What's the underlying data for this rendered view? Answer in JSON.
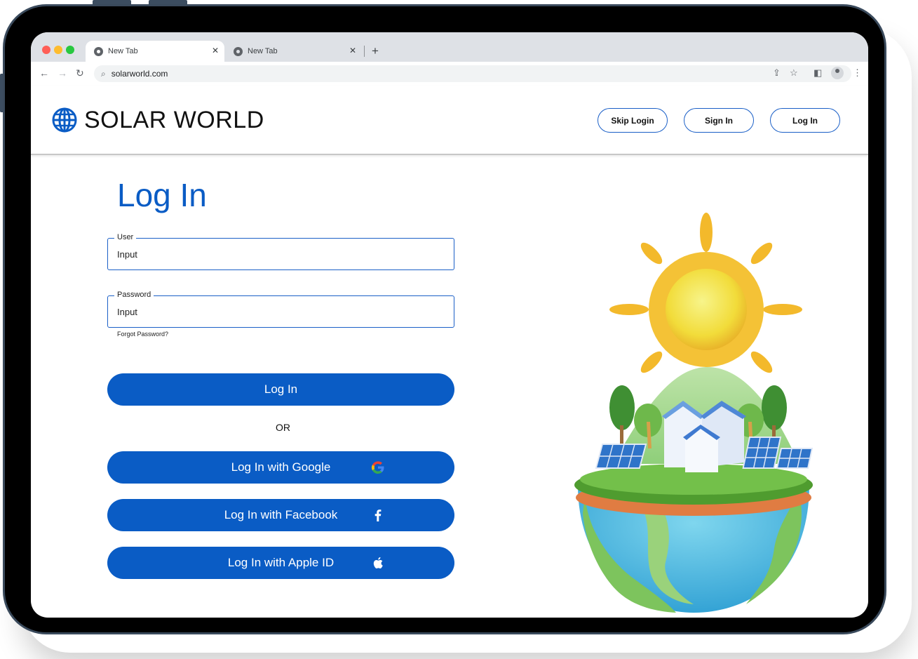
{
  "browser": {
    "tabs": [
      {
        "title": "New Tab"
      },
      {
        "title": "New Tab"
      }
    ],
    "url": "solarworld.com"
  },
  "header": {
    "logo_text": "SOLAR WORLD",
    "buttons": {
      "skip_login": "Skip Login",
      "sign_in": "Sign In",
      "log_in": "Log In"
    }
  },
  "login": {
    "title": "Log In",
    "user": {
      "label": "User",
      "value": "Input"
    },
    "password": {
      "label": "Password",
      "value": "Input"
    },
    "forgot_password": "Forgot Password?",
    "submit_label": "Log In",
    "divider": "OR",
    "google_label": "Log In with Google",
    "facebook_label": "Log In with Facebook",
    "apple_label": "Log In with Apple ID"
  },
  "colors": {
    "brand_blue": "#0a5cc5",
    "browser_chrome": "#dee1e6"
  },
  "icons": {
    "logo": "globe-icon",
    "google": "google-icon",
    "facebook": "facebook-icon",
    "apple": "apple-icon"
  }
}
